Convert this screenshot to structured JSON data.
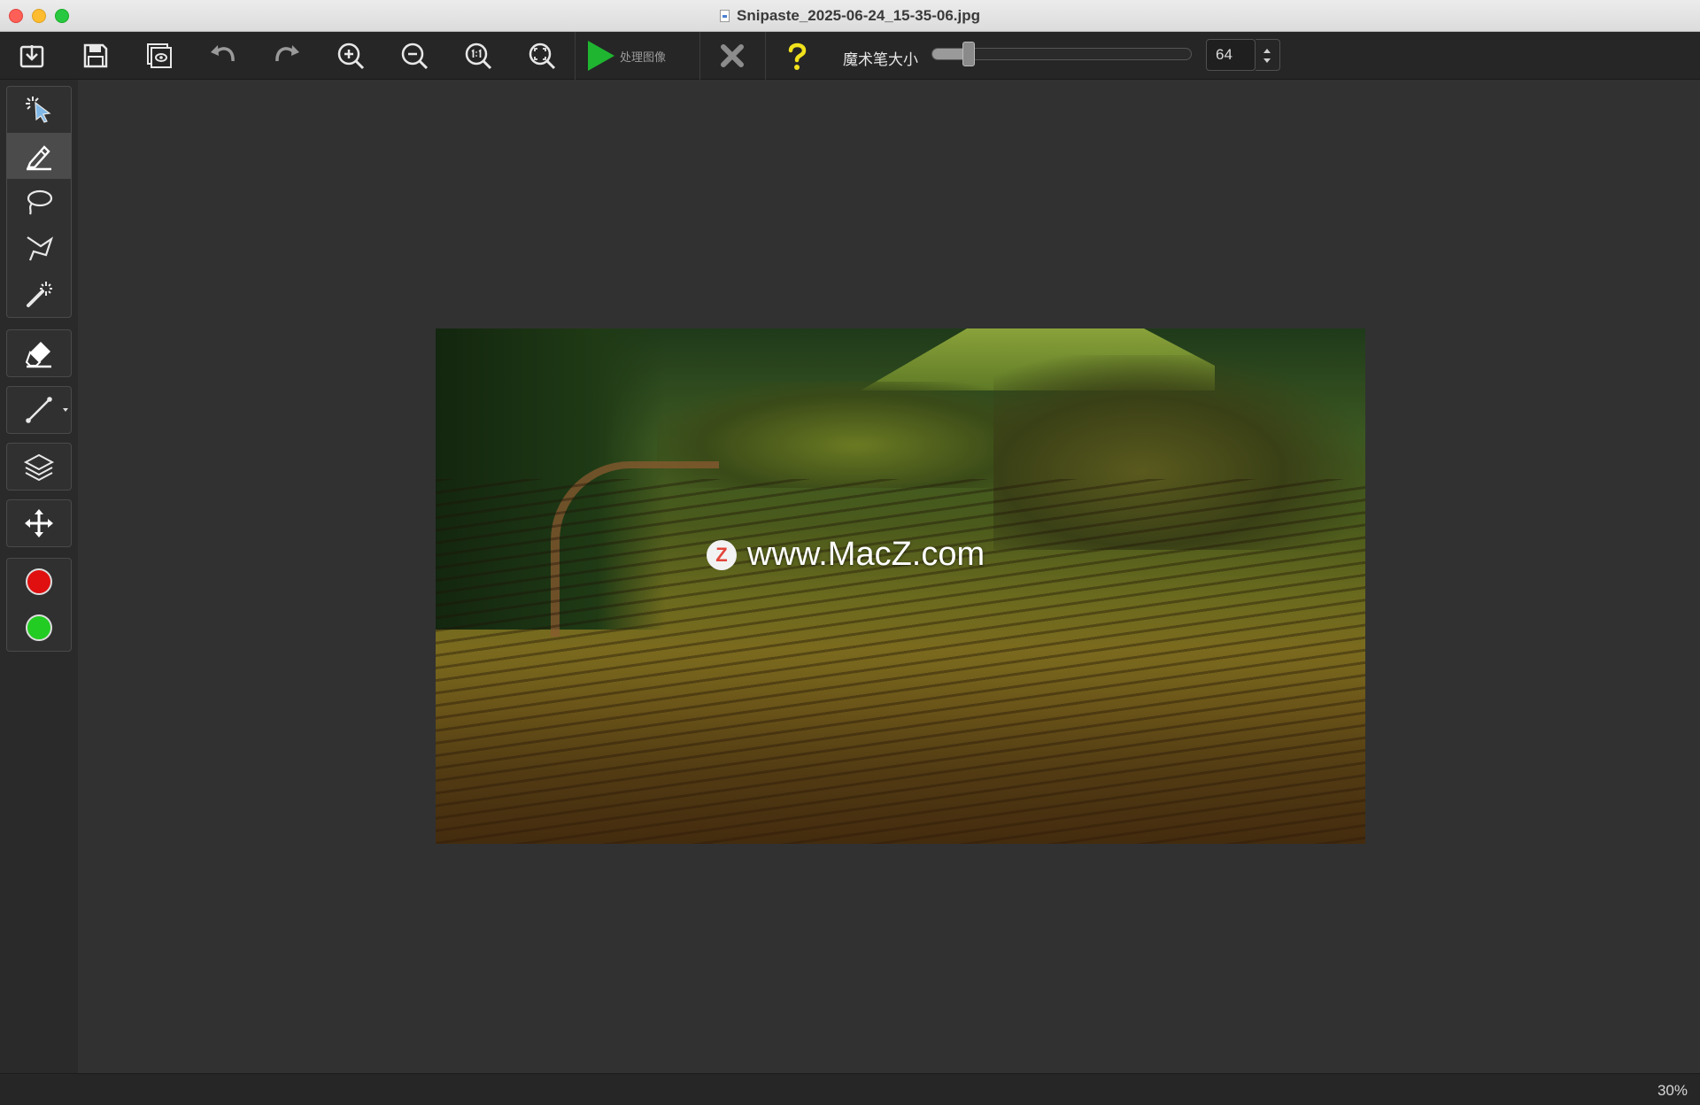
{
  "window": {
    "title": "Snipaste_2025-06-24_15-35-06.jpg"
  },
  "toolbar": {
    "process_label": "处理图像",
    "brush_size_label": "魔术笔大小",
    "brush_size_value": "64",
    "brush_slider_level": 0.14,
    "icons": [
      "import-icon",
      "save-icon",
      "preview-icon",
      "undo-icon",
      "redo-icon",
      "zoom-in-icon",
      "zoom-out-icon",
      "actual-size-icon",
      "fit-icon",
      "process-icon",
      "cancel-icon",
      "help-icon"
    ]
  },
  "tools": {
    "items": [
      "auto-select-icon",
      "marker-icon",
      "lasso-icon",
      "polygon-lasso-icon",
      "magic-wand-icon",
      "eraser-icon",
      "line-icon",
      "layers-icon",
      "move-icon"
    ],
    "active": "marker-icon",
    "colors": {
      "remove": "#e01010",
      "keep": "#22cc22"
    }
  },
  "canvas": {
    "watermark_text": "www.MacZ.com",
    "watermark_logo": "Z"
  },
  "status": {
    "zoom": "30%"
  }
}
